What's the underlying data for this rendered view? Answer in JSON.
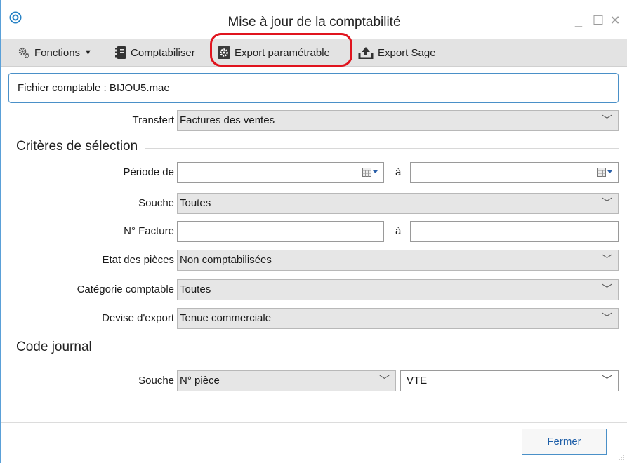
{
  "window": {
    "title": "Mise à jour de la comptabilité",
    "controls": {
      "minimize": "_",
      "maximize": "☐",
      "close": "✕"
    }
  },
  "toolbar": {
    "fonctions": "Fonctions",
    "comptabiliser": "Comptabiliser",
    "export_parametrable": "Export paramétrable",
    "export_sage": "Export Sage"
  },
  "file": {
    "text": "Fichier comptable : BIJOU5.mae"
  },
  "transfert": {
    "label": "Transfert",
    "value": "Factures des ventes"
  },
  "criteres": {
    "title": "Critères de sélection",
    "periode": {
      "label": "Période de",
      "from": "",
      "to_label": "à",
      "to": ""
    },
    "souche": {
      "label": "Souche",
      "value": "Toutes"
    },
    "facture": {
      "label": "N° Facture",
      "from": "",
      "to_label": "à",
      "to": ""
    },
    "etat": {
      "label": "Etat des pièces",
      "value": "Non comptabilisées"
    },
    "categorie": {
      "label": "Catégorie comptable",
      "value": "Toutes"
    },
    "devise": {
      "label": "Devise d'export",
      "value": "Tenue commerciale"
    }
  },
  "journal": {
    "title": "Code journal",
    "souche": {
      "label": "Souche",
      "value": "N° pièce",
      "code": "VTE"
    }
  },
  "footer": {
    "fermer": "Fermer"
  },
  "colors": {
    "accent": "#4a90c8",
    "highlight": "#e0141e",
    "toolbar_bg": "#e3e3e3"
  },
  "icons": [
    "app-logo-icon",
    "gear-icon",
    "journal-icon",
    "settings-gear-icon",
    "upload-icon",
    "calendar-icon",
    "chevron-down-icon",
    "resize-grip-icon"
  ]
}
